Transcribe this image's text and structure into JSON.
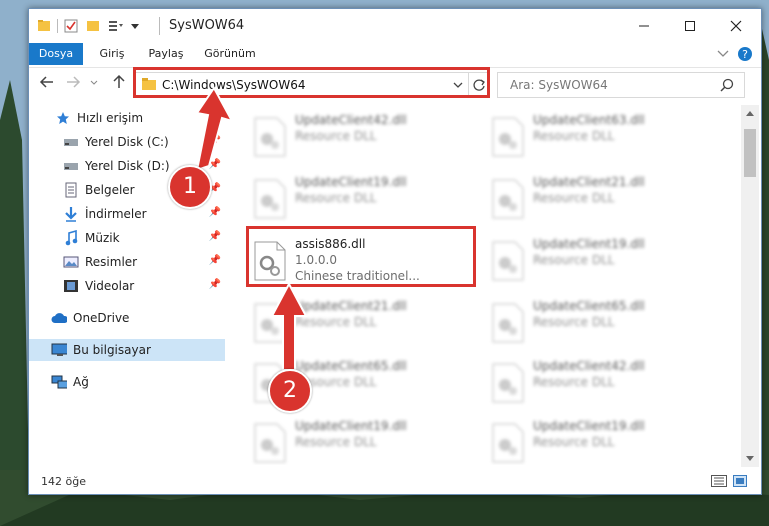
{
  "window": {
    "title": "SysWOW64",
    "minimize_icon": "minimize-icon",
    "maximize_icon": "maximize-icon",
    "close_icon": "close-icon"
  },
  "ribbon": {
    "tabs": [
      {
        "label": "Dosya",
        "active": true
      },
      {
        "label": "Giriş",
        "active": false
      },
      {
        "label": "Paylaş",
        "active": false
      },
      {
        "label": "Görünüm",
        "active": false
      }
    ]
  },
  "address": {
    "path": "C:\\Windows\\SysWOW64",
    "search_placeholder": "Ara: SysWOW64"
  },
  "sidebar": {
    "items": [
      {
        "label": "Hızlı erişim",
        "icon": "star-icon",
        "pinned": false
      },
      {
        "label": "Yerel Disk (C:)",
        "icon": "drive-icon",
        "pinned": true
      },
      {
        "label": "Yerel Disk (D:)",
        "icon": "drive-icon",
        "pinned": true
      },
      {
        "label": "Belgeler",
        "icon": "documents-icon",
        "pinned": true
      },
      {
        "label": "İndirmeler",
        "icon": "download-icon",
        "pinned": true
      },
      {
        "label": "Müzik",
        "icon": "music-icon",
        "pinned": true
      },
      {
        "label": "Resimler",
        "icon": "pictures-icon",
        "pinned": true
      },
      {
        "label": "Videolar",
        "icon": "video-icon",
        "pinned": true
      },
      {
        "label": "OneDrive",
        "icon": "cloud-icon",
        "pinned": false
      },
      {
        "label": "Bu bilgisayar",
        "icon": "computer-icon",
        "pinned": false,
        "selected": true
      },
      {
        "label": "Ağ",
        "icon": "network-icon",
        "pinned": false
      }
    ]
  },
  "files": {
    "left": [
      {
        "name": "UpdateClient42.dll",
        "sub": "Resource DLL"
      },
      {
        "name": "UpdateClient19.dll",
        "sub": "Resource DLL"
      },
      {
        "name": "assis886.dll",
        "version": "1.0.0.0",
        "sub": "Chinese traditionel...",
        "highlighted": true
      },
      {
        "name": "UpdateClient21.dll",
        "sub": "Resource DLL"
      },
      {
        "name": "UpdateClient65.dll",
        "sub": "Resource DLL"
      },
      {
        "name": "UpdateClient19.dll",
        "sub": "Resource DLL"
      }
    ],
    "right": [
      {
        "name": "UpdateClient63.dll",
        "sub": "Resource DLL"
      },
      {
        "name": "UpdateClient21.dll",
        "sub": "Resource DLL"
      },
      {
        "name": "UpdateClient19.dll",
        "sub": "Resource DLL"
      },
      {
        "name": "UpdateClient65.dll",
        "sub": "Resource DLL"
      },
      {
        "name": "UpdateClient42.dll",
        "sub": "Resource DLL"
      },
      {
        "name": "UpdateClient19.dll",
        "sub": "Resource DLL"
      }
    ]
  },
  "status": {
    "count": "142 öğe"
  },
  "callouts": {
    "one": "1",
    "two": "2"
  },
  "colors": {
    "accent": "#1979ca",
    "callout": "#d9342e",
    "selected": "#cce4f7"
  }
}
